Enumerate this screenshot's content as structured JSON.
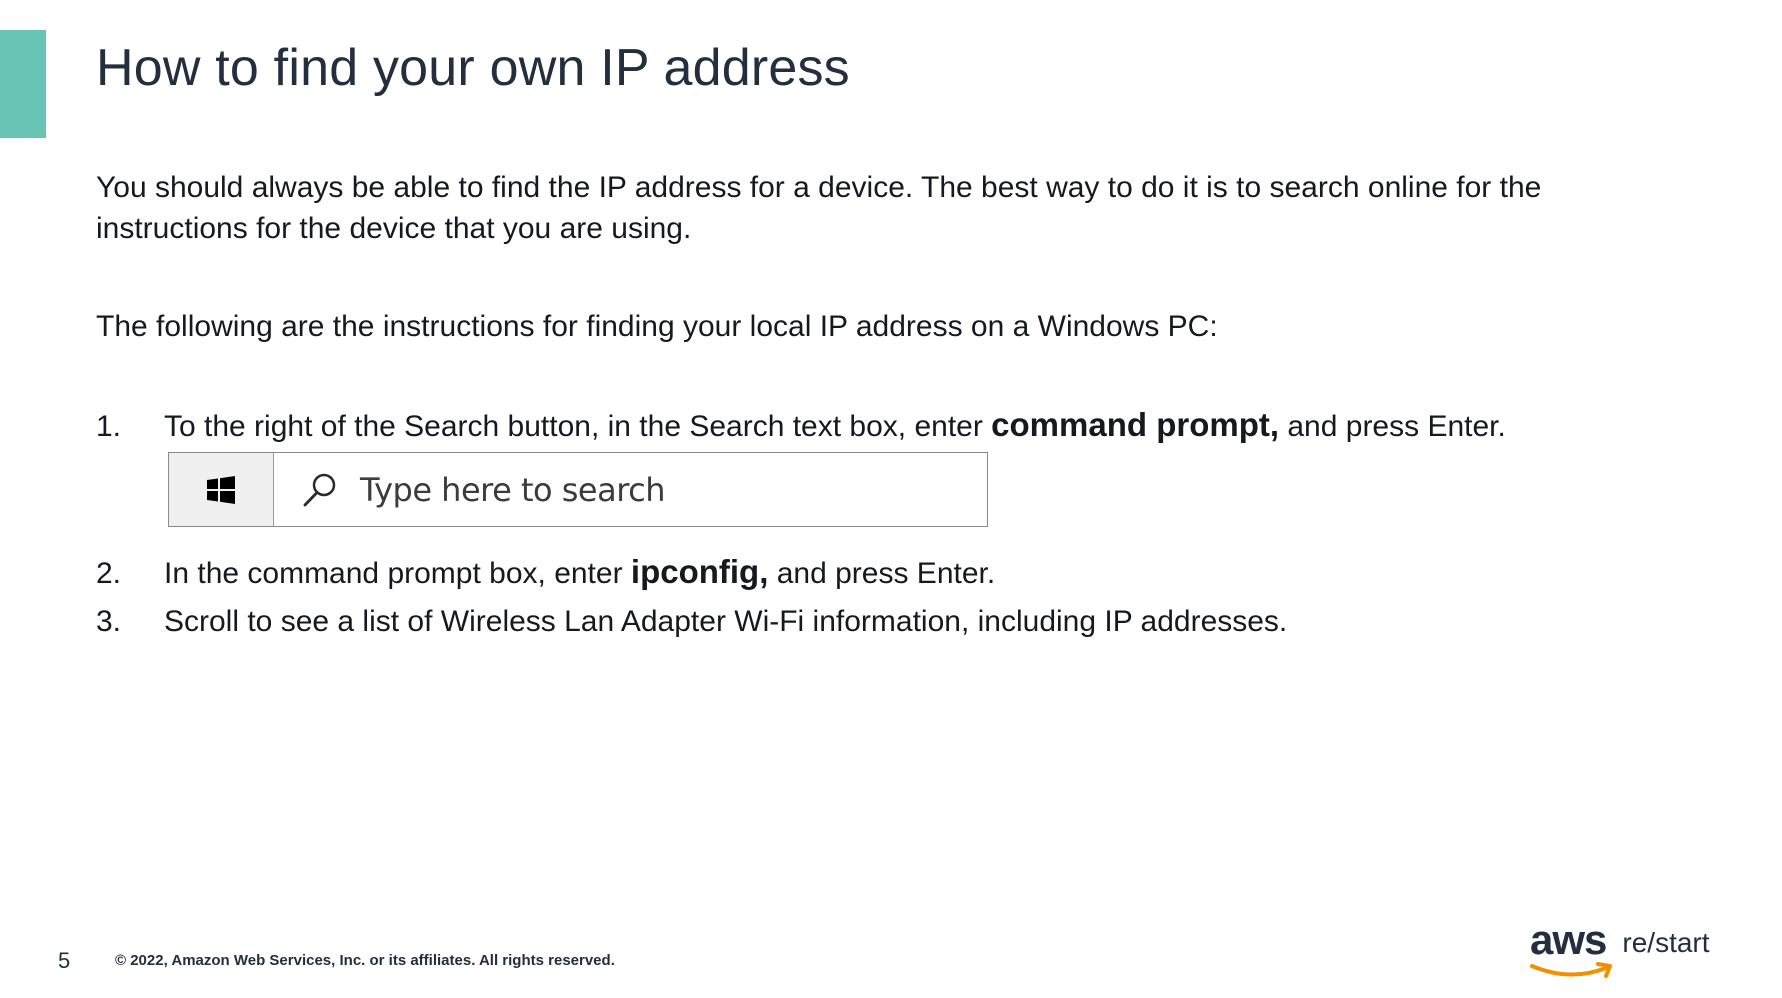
{
  "slide": {
    "title": "How to find your own IP address",
    "paragraph_1": "You should always be able to find the IP address for a device. The best way to do it is to search online for the instructions for the device that you are using.",
    "paragraph_2": "The following are the instructions for finding your local IP address on a Windows PC:",
    "steps": [
      {
        "number": "1.",
        "before": "To the right of the Search button, in the Search text box, enter ",
        "bold": "command prompt,",
        "after": " and press Enter."
      },
      {
        "number": "2.",
        "before": "In the command prompt box, enter ",
        "bold": "ipconfig,",
        "after": " and press Enter."
      },
      {
        "number": "3.",
        "text": "Scroll to see a list of Wireless Lan Adapter Wi-Fi information, including IP addresses."
      }
    ],
    "taskbar_search": {
      "placeholder": "Type here to search",
      "windows_icon": "windows-logo-icon",
      "search_icon": "search-icon"
    }
  },
  "footer": {
    "page_number": "5",
    "copyright": "© 2022, Amazon Web Services, Inc. or its affiliates. All rights reserved.",
    "logo_main": "aws",
    "logo_sub": "re/start"
  },
  "colors": {
    "accent": "#68c3b4",
    "text": "#16191f",
    "title": "#232f3e",
    "aws_smile": "#f29100"
  }
}
